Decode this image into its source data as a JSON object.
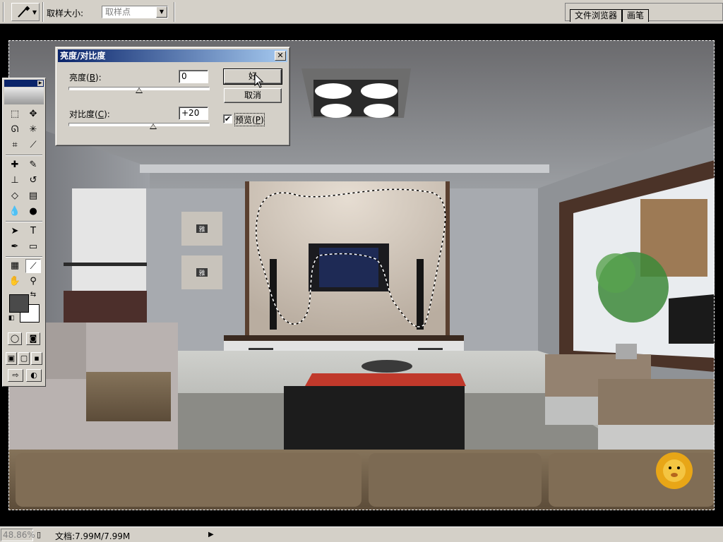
{
  "options_bar": {
    "sample_size_label": "取样大小:",
    "sample_size_value": "取样点",
    "palette_well_tabs": [
      "文件浏览器",
      "画笔"
    ]
  },
  "dialog": {
    "title": "亮度/对比度",
    "brightness_label": "亮度(",
    "brightness_key": "B",
    "brightness_label_end": "):",
    "brightness_value": "0",
    "brightness_slider_fraction": 0.5,
    "contrast_label": "对比度(",
    "contrast_key": "C",
    "contrast_label_end": "):",
    "contrast_value": "+20",
    "contrast_slider_fraction": 0.6,
    "ok_label": "好",
    "cancel_label": "取消",
    "preview_label": "预览(",
    "preview_key": "P",
    "preview_label_end": ")",
    "preview_checked": "✔"
  },
  "canvas": {
    "tv_labels": [
      "雅",
      "雅"
    ]
  },
  "status_bar": {
    "zoom": "48.86%",
    "doc_info": "文档:7.99M/7.99M"
  },
  "colors": {
    "title_bar": "#0a246a",
    "chrome": "#d4d0c8",
    "foreground_swatch": "#4a4a4a",
    "background_swatch": "#ffffff"
  }
}
